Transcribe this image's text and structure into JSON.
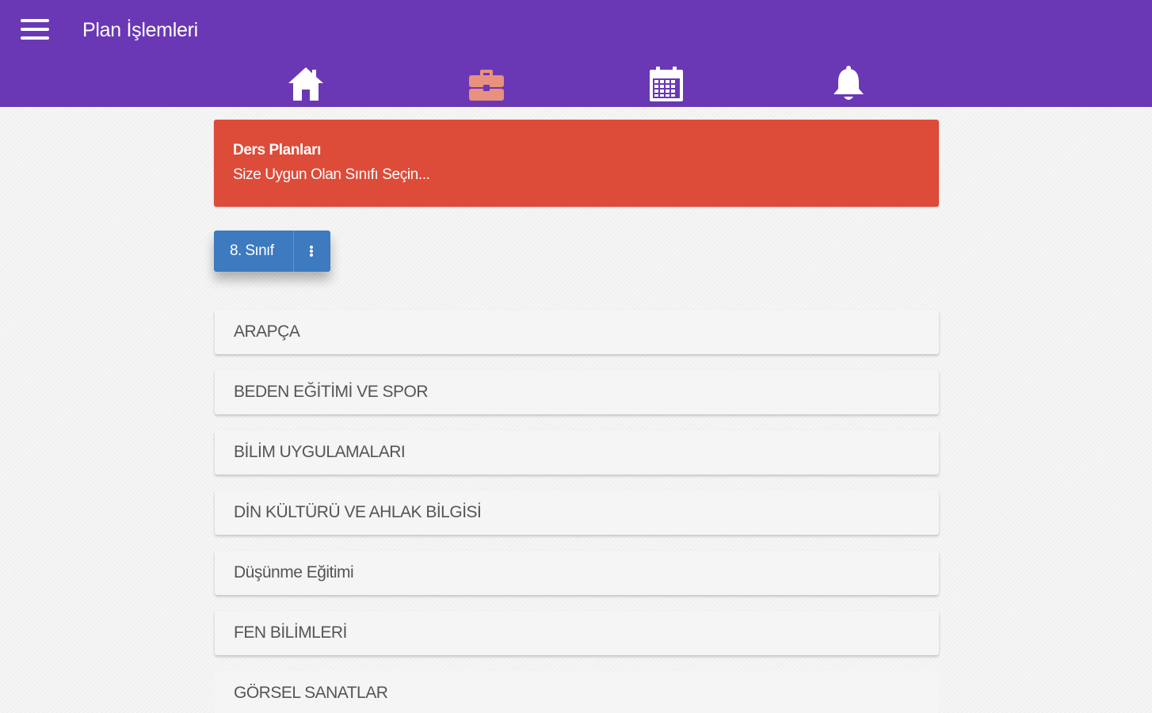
{
  "header": {
    "title": "Plan İşlemleri",
    "menu_icon": "hamburger-menu-icon",
    "background_color": "#6a38b5"
  },
  "nav": [
    {
      "icon": "home-icon",
      "color": "#ffffff"
    },
    {
      "icon": "briefcase-icon",
      "color": "#e8917e"
    },
    {
      "icon": "calendar-icon",
      "color": "#ffffff"
    },
    {
      "icon": "bell-icon",
      "color": "#ffffff"
    }
  ],
  "alert": {
    "title": "Ders Planları",
    "subtitle": "Size Uygun Olan Sınıfı Seçin...",
    "color": "#dd4b39"
  },
  "class_selector": {
    "label": "8. Sınıf",
    "icon": "more-vertical-icon",
    "color": "#3d7ac0"
  },
  "subjects": [
    "ARAPÇA",
    "BEDEN EĞİTİMİ VE SPOR",
    "BİLİM UYGULAMALARI",
    "DİN KÜLTÜRÜ VE AHLAK BİLGİSİ",
    "Düşünme Eğitimi",
    "FEN BİLİMLERİ",
    "GÖRSEL SANATLAR"
  ]
}
